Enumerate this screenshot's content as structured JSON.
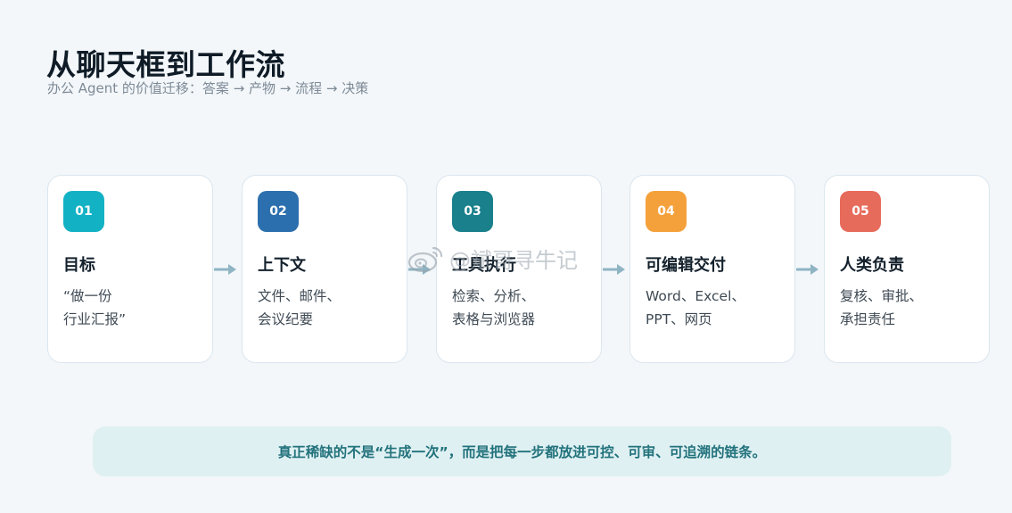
{
  "header": {
    "title": "从聊天框到工作流",
    "subtitle": "办公 Agent 的价值迁移：答案 → 产物 → 流程 → 决策"
  },
  "steps": [
    {
      "number": "01",
      "title": "目标",
      "desc_line1": "“做一份",
      "desc_line2": "行业汇报”",
      "color": "#13b1c4"
    },
    {
      "number": "02",
      "title": "上下文",
      "desc_line1": "文件、邮件、",
      "desc_line2": "会议纪要",
      "color": "#2c6fae"
    },
    {
      "number": "03",
      "title": "工具执行",
      "desc_line1": "检索、分析、",
      "desc_line2": "表格与浏览器",
      "color": "#19808c"
    },
    {
      "number": "04",
      "title": "可编辑交付",
      "desc_line1": "Word、Excel、",
      "desc_line2": "PPT、网页",
      "color": "#f5a13b"
    },
    {
      "number": "05",
      "title": "人类负责",
      "desc_line1": "复核、审批、",
      "desc_line2": "承担责任",
      "color": "#e76b5b"
    }
  ],
  "watermark": {
    "text": "@斌哥寻牛记"
  },
  "footer": {
    "text": "真正稀缺的不是“生成一次”，而是把每一步都放进可控、可审、可追溯的链条。"
  },
  "colors": {
    "background": "#f3f7fa",
    "arrow": "#8fb4c3",
    "banner_bg": "#dff0f2",
    "banner_text": "#22727c"
  }
}
